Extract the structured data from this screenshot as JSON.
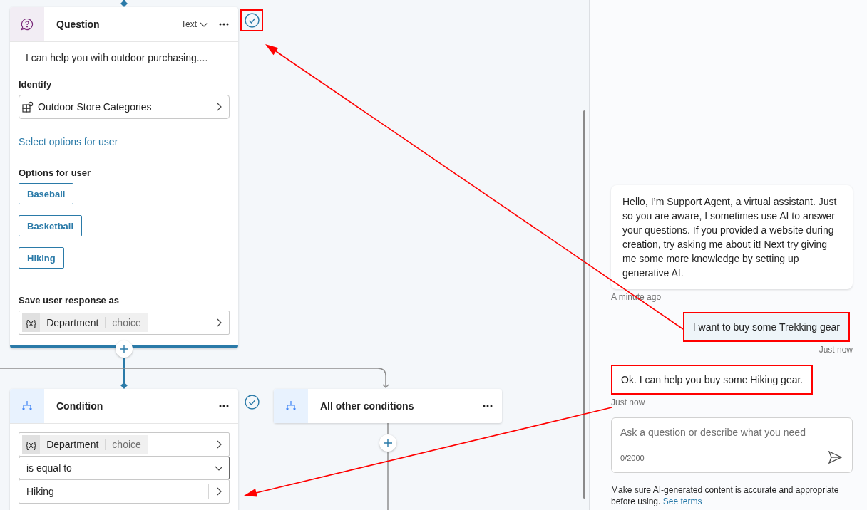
{
  "canvas": {
    "nodes": [
      {
        "kind": "question",
        "title": "Question",
        "mode": "Text",
        "message": "I can help you with outdoor purchasing....",
        "identify_label": "Identify",
        "identify_value": "Outdoor Store Categories",
        "link": "Select options for user",
        "options_label": "Options for user",
        "options": [
          "Baseball",
          "Basketball",
          "Hiking"
        ],
        "save_label": "Save user response as",
        "variable": {
          "badge": "{x}",
          "name": "Department",
          "type": "choice"
        },
        "checked": true,
        "highlighted": true
      },
      {
        "kind": "condition",
        "title": "Condition",
        "variable": {
          "badge": "{x}",
          "name": "Department",
          "type": "choice"
        },
        "operator": "is equal to",
        "value": "Hiking",
        "checked": true
      },
      {
        "kind": "other",
        "title": "All other conditions"
      }
    ]
  },
  "chat": {
    "messages": [
      {
        "kind": "bot",
        "text": "Hello, I’m Support Agent, a virtual assistant. Just so you are aware, I sometimes use AI to answer your questions. If you provided a website during creation, try asking me about it! Next try giving me some more knowledge by setting up generative AI.",
        "time": "A minute ago",
        "highlighted": false
      },
      {
        "kind": "user",
        "text": "I want to buy some Trekking gear",
        "time": "Just now",
        "highlighted": true
      },
      {
        "kind": "bot",
        "text": "Ok. I can help you buy some Hiking gear.",
        "time": "Just now",
        "highlighted": true
      }
    ],
    "input": {
      "placeholder": "Ask a question or describe what you need",
      "counter": "0/2000"
    },
    "disclaimer": "Make sure AI-generated content is accurate and appropriate before using.",
    "terms_link": "See terms"
  }
}
